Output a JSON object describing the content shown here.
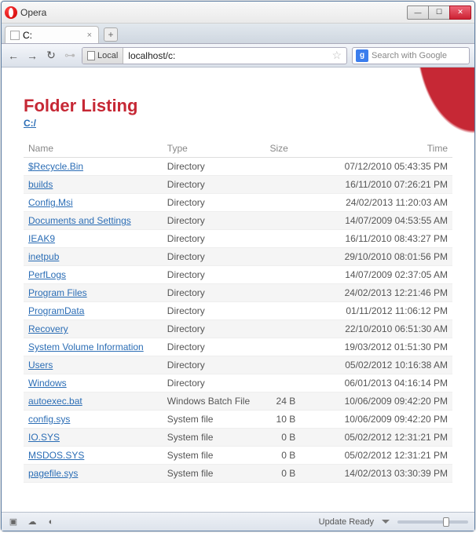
{
  "app": {
    "name": "Opera"
  },
  "tab": {
    "title": "C:"
  },
  "address": {
    "local_label": "Local",
    "url": "localhost/c:"
  },
  "search": {
    "provider_letter": "g",
    "placeholder": "Search with Google"
  },
  "page": {
    "heading": "Folder Listing",
    "path": "C:/",
    "columns": {
      "name": "Name",
      "type": "Type",
      "size": "Size",
      "time": "Time"
    },
    "rows": [
      {
        "name": "$Recycle.Bin",
        "type": "Directory",
        "size": "",
        "time": "07/12/2010 05:43:35 PM"
      },
      {
        "name": "builds",
        "type": "Directory",
        "size": "",
        "time": "16/11/2010 07:26:21 PM"
      },
      {
        "name": "Config.Msi",
        "type": "Directory",
        "size": "",
        "time": "24/02/2013 11:20:03 AM"
      },
      {
        "name": "Documents and Settings",
        "type": "Directory",
        "size": "",
        "time": "14/07/2009 04:53:55 AM"
      },
      {
        "name": "IEAK9",
        "type": "Directory",
        "size": "",
        "time": "16/11/2010 08:43:27 PM"
      },
      {
        "name": "inetpub",
        "type": "Directory",
        "size": "",
        "time": "29/10/2010 08:01:56 PM"
      },
      {
        "name": "PerfLogs",
        "type": "Directory",
        "size": "",
        "time": "14/07/2009 02:37:05 AM"
      },
      {
        "name": "Program Files",
        "type": "Directory",
        "size": "",
        "time": "24/02/2013 12:21:46 PM"
      },
      {
        "name": "ProgramData",
        "type": "Directory",
        "size": "",
        "time": "01/11/2012 11:06:12 PM"
      },
      {
        "name": "Recovery",
        "type": "Directory",
        "size": "",
        "time": "22/10/2010 06:51:30 AM"
      },
      {
        "name": "System Volume Information",
        "type": "Directory",
        "size": "",
        "time": "19/03/2012 01:51:30 PM"
      },
      {
        "name": "Users",
        "type": "Directory",
        "size": "",
        "time": "05/02/2012 10:16:38 AM"
      },
      {
        "name": "Windows",
        "type": "Directory",
        "size": "",
        "time": "06/01/2013 04:16:14 PM"
      },
      {
        "name": "autoexec.bat",
        "type": "Windows Batch File",
        "size": "24 B",
        "time": "10/06/2009 09:42:20 PM"
      },
      {
        "name": "config.sys",
        "type": "System file",
        "size": "10 B",
        "time": "10/06/2009 09:42:20 PM"
      },
      {
        "name": "IO.SYS",
        "type": "System file",
        "size": "0 B",
        "time": "05/02/2012 12:31:21 PM"
      },
      {
        "name": "MSDOS.SYS",
        "type": "System file",
        "size": "0 B",
        "time": "05/02/2012 12:31:21 PM"
      },
      {
        "name": "pagefile.sys",
        "type": "System file",
        "size": "0 B",
        "time": "14/02/2013 03:30:39 PM"
      }
    ]
  },
  "status": {
    "update": "Update Ready"
  }
}
